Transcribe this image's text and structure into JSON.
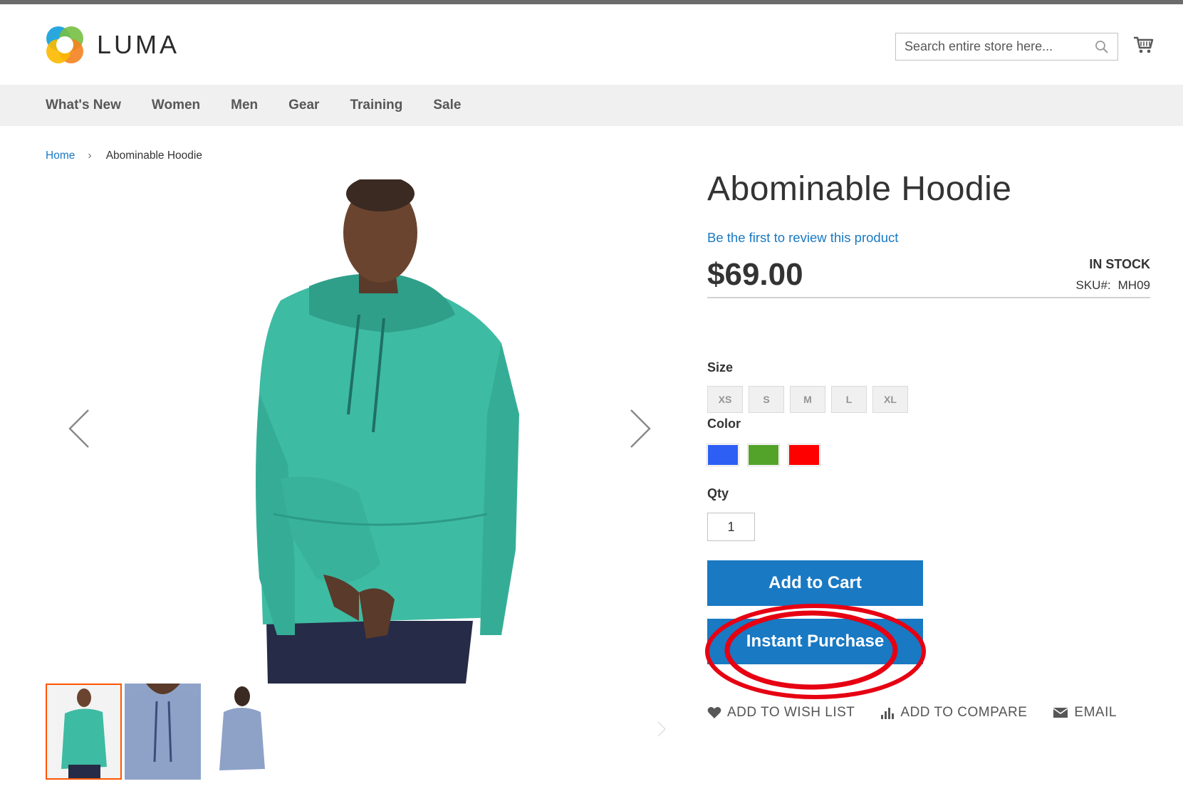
{
  "header": {
    "brand": "LUMA",
    "search_placeholder": "Search entire store here...",
    "cart_icon": "cart-icon",
    "search_icon": "search-icon"
  },
  "nav": {
    "items": [
      "What's New",
      "Women",
      "Men",
      "Gear",
      "Training",
      "Sale"
    ]
  },
  "breadcrumb": {
    "home": "Home",
    "separator": "›",
    "current": "Abominable Hoodie"
  },
  "product": {
    "title": "Abominable Hoodie",
    "review_link": "Be the first to review this product",
    "price": "$69.00",
    "stock": "IN STOCK",
    "sku_label": "SKU#:",
    "sku": "MH09",
    "size_label": "Size",
    "sizes": [
      "XS",
      "S",
      "M",
      "L",
      "XL"
    ],
    "color_label": "Color",
    "colors": [
      "#2e5ff5",
      "#53a32b",
      "#ff0000"
    ],
    "qty_label": "Qty",
    "qty_value": "1",
    "add_to_cart": "Add to Cart",
    "instant_purchase": "Instant Purchase",
    "annotation_color": "#e60012"
  },
  "actions": {
    "wishlist": "ADD TO WISH LIST",
    "compare": "ADD TO COMPARE",
    "email": "EMAIL"
  },
  "gallery": {
    "thumb_count": 3,
    "active_thumb": 0,
    "accent": "#ff5501"
  }
}
